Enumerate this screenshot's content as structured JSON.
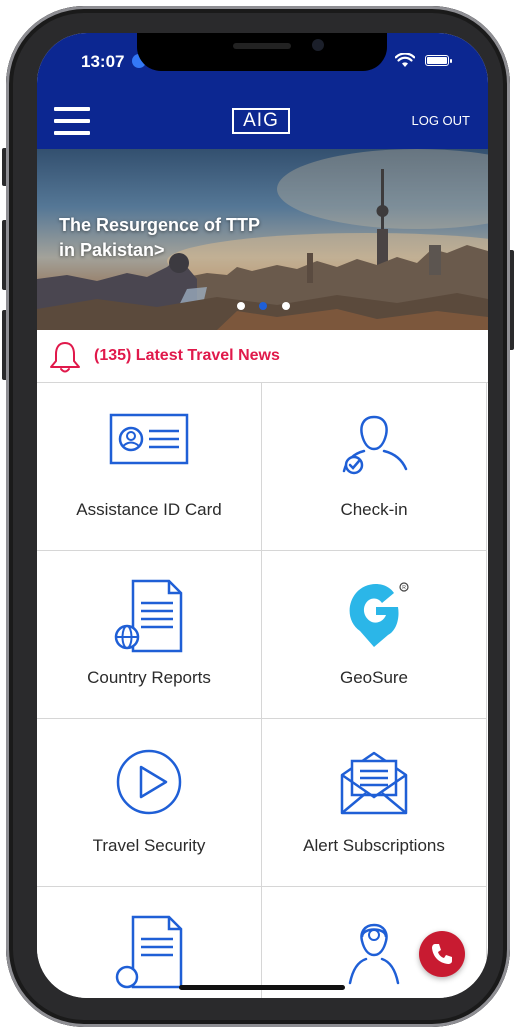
{
  "status_bar": {
    "time": "13:07"
  },
  "app_bar": {
    "logo": "AIG",
    "logout_label": "LOG OUT"
  },
  "hero": {
    "headline_line1": "The Resurgence of TTP",
    "headline_line2": "in Pakistan>",
    "dots": [
      {
        "active": false
      },
      {
        "active": true
      },
      {
        "active": false
      }
    ]
  },
  "news": {
    "label": "(135) Latest Travel News"
  },
  "tiles": [
    {
      "label": "Assistance ID Card",
      "icon": "id-card-icon"
    },
    {
      "label": "Check-in",
      "icon": "person-check-icon"
    },
    {
      "label": "Country Reports",
      "icon": "globe-document-icon"
    },
    {
      "label": "GeoSure",
      "icon": "geosure-logo-icon"
    },
    {
      "label": "Travel Security",
      "icon": "play-circle-icon"
    },
    {
      "label": "Alert Subscriptions",
      "icon": "envelope-letter-icon"
    },
    {
      "label": "",
      "icon": "document-icon"
    },
    {
      "label": "",
      "icon": "person-headset-icon"
    }
  ],
  "colors": {
    "brand": "#0c2791",
    "accent": "#e0194b",
    "icon": "#1f5fd6",
    "call": "#c81b31"
  }
}
